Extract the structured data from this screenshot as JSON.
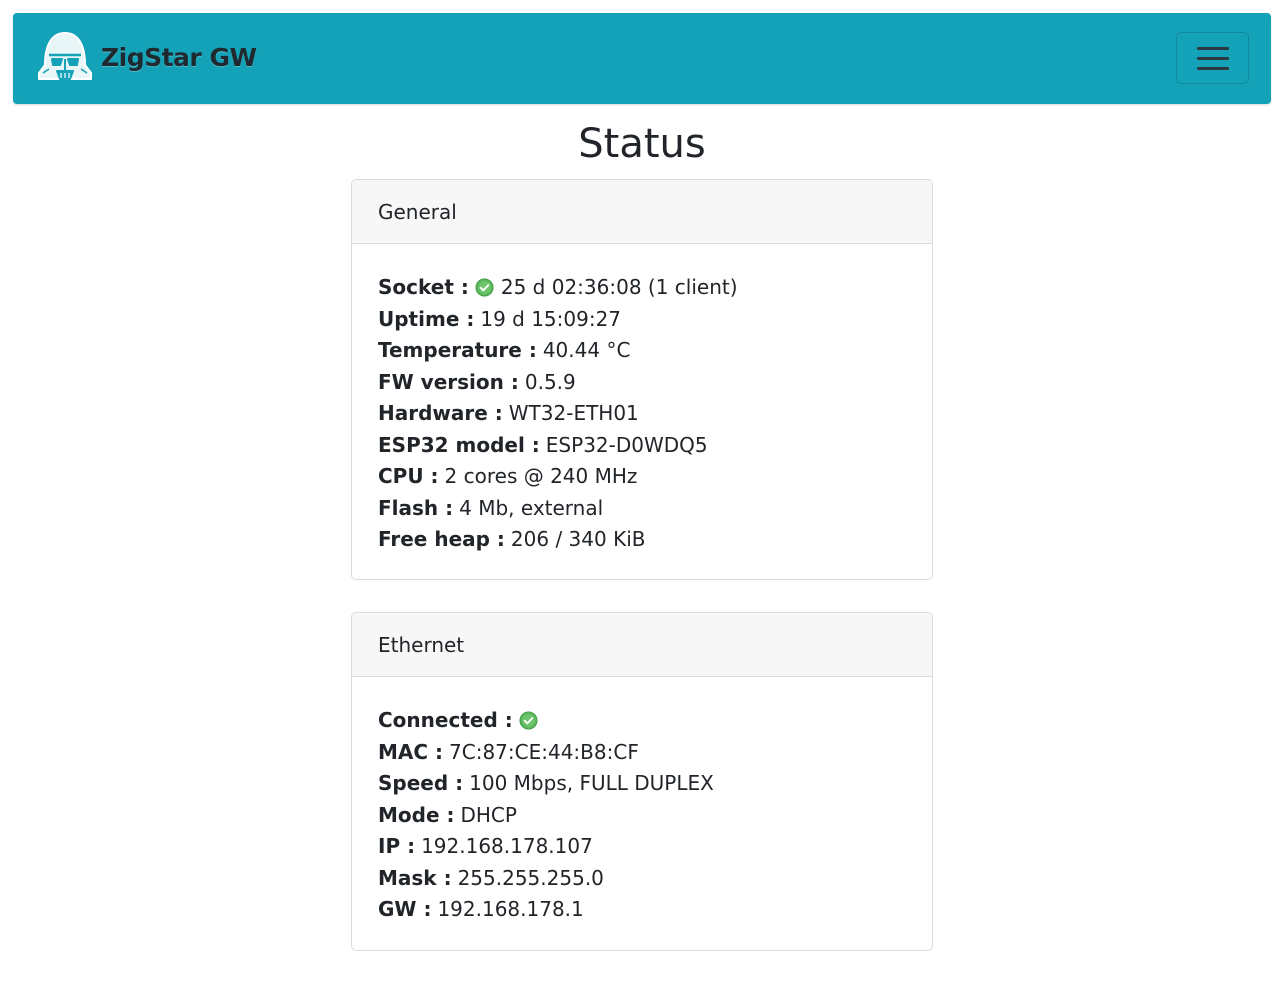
{
  "navbar": {
    "brand": "ZigStar GW",
    "logo_icon": "darth-vader-helmet-icon",
    "menu_icon": "hamburger-menu-icon",
    "color": "#14a2b8"
  },
  "page": {
    "title": "Status"
  },
  "general": {
    "header": "General",
    "rows": [
      {
        "label": "Socket :",
        "value": "25 d 02:36:08 (1 client)",
        "icon": "check-circle-icon"
      },
      {
        "label": "Uptime :",
        "value": "19 d 15:09:27"
      },
      {
        "label": "Temperature :",
        "value": "40.44 °C"
      },
      {
        "label": "FW version :",
        "value": "0.5.9"
      },
      {
        "label": "Hardware :",
        "value": "WT32-ETH01"
      },
      {
        "label": "ESP32 model :",
        "value": "ESP32-D0WDQ5"
      },
      {
        "label": "CPU :",
        "value": "2 cores @ 240 MHz"
      },
      {
        "label": "Flash :",
        "value": "4 Mb, external"
      },
      {
        "label": "Free heap :",
        "value": "206 / 340 KiB"
      }
    ]
  },
  "ethernet": {
    "header": "Ethernet",
    "rows": [
      {
        "label": "Connected :",
        "value": "",
        "icon": "check-circle-icon"
      },
      {
        "label": "MAC :",
        "value": "7C:87:CE:44:B8:CF"
      },
      {
        "label": "Speed :",
        "value": "100 Mbps, FULL DUPLEX"
      },
      {
        "label": "Mode :",
        "value": "DHCP"
      },
      {
        "label": "IP :",
        "value": "192.168.178.107"
      },
      {
        "label": "Mask :",
        "value": "255.255.255.0"
      },
      {
        "label": "GW :",
        "value": "192.168.178.1"
      }
    ]
  },
  "colors": {
    "check": "#5cb85c"
  }
}
